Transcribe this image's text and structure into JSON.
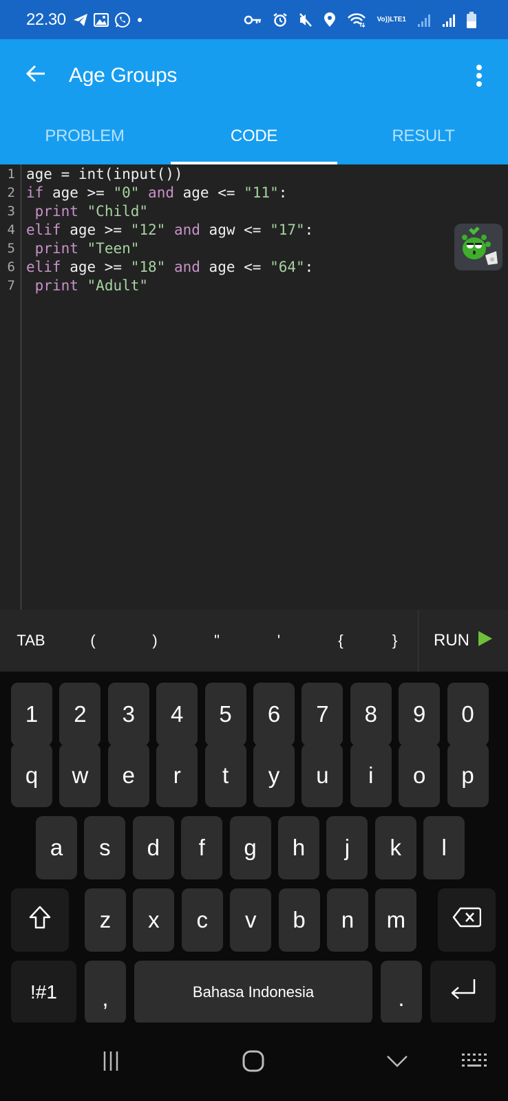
{
  "status_bar": {
    "time": "22.30",
    "left_icons": [
      "telegram-icon",
      "gallery-icon",
      "whatsapp-icon",
      "dot-icon"
    ],
    "right_icons": [
      "vpn-key-icon",
      "alarm-icon",
      "mute-icon",
      "location-icon",
      "wifi-icon",
      "volte-icon",
      "signal-icon",
      "signal-icon",
      "battery-icon"
    ],
    "volte_label": "Vo))",
    "lte_label": "LTE1"
  },
  "app_bar": {
    "title": "Age Groups",
    "back_icon": "arrow-left-icon",
    "menu_icon": "more-vert-icon",
    "tabs": [
      {
        "label": "PROBLEM",
        "active": false
      },
      {
        "label": "CODE",
        "active": true
      },
      {
        "label": "RESULT",
        "active": false
      }
    ]
  },
  "editor": {
    "lines": [
      {
        "num": "1",
        "tokens": [
          {
            "t": "plain",
            "v": "age = int(input())"
          }
        ]
      },
      {
        "num": "2",
        "tokens": [
          {
            "t": "kw",
            "v": "if"
          },
          {
            "t": "plain",
            "v": " age >= "
          },
          {
            "t": "str",
            "v": "\"0\""
          },
          {
            "t": "plain",
            "v": " "
          },
          {
            "t": "kw",
            "v": "and"
          },
          {
            "t": "plain",
            "v": " age <= "
          },
          {
            "t": "str",
            "v": "\"11\""
          },
          {
            "t": "plain",
            "v": ":"
          }
        ]
      },
      {
        "num": "3",
        "tokens": [
          {
            "t": "plain",
            "v": " "
          },
          {
            "t": "kw",
            "v": "print"
          },
          {
            "t": "plain",
            "v": " "
          },
          {
            "t": "str",
            "v": "\"Child\""
          }
        ]
      },
      {
        "num": "4",
        "tokens": [
          {
            "t": "kw",
            "v": "elif"
          },
          {
            "t": "plain",
            "v": " age >= "
          },
          {
            "t": "str",
            "v": "\"12\""
          },
          {
            "t": "plain",
            "v": " "
          },
          {
            "t": "kw",
            "v": "and"
          },
          {
            "t": "plain",
            "v": " agw <= "
          },
          {
            "t": "str",
            "v": "\"17\""
          },
          {
            "t": "plain",
            "v": ":"
          }
        ]
      },
      {
        "num": "5",
        "tokens": [
          {
            "t": "plain",
            "v": " "
          },
          {
            "t": "kw",
            "v": "print"
          },
          {
            "t": "plain",
            "v": " "
          },
          {
            "t": "str",
            "v": "\"Teen\""
          }
        ]
      },
      {
        "num": "6",
        "tokens": [
          {
            "t": "kw",
            "v": "elif"
          },
          {
            "t": "plain",
            "v": " age >= "
          },
          {
            "t": "str",
            "v": "\"18\""
          },
          {
            "t": "plain",
            "v": " "
          },
          {
            "t": "kw",
            "v": "and"
          },
          {
            "t": "plain",
            "v": " age <= "
          },
          {
            "t": "str",
            "v": "\"64\""
          },
          {
            "t": "plain",
            "v": ":"
          }
        ]
      },
      {
        "num": "7",
        "tokens": [
          {
            "t": "plain",
            "v": " "
          },
          {
            "t": "kw",
            "v": "print"
          },
          {
            "t": "plain",
            "v": " "
          },
          {
            "t": "str",
            "v": "\"Adult\""
          }
        ]
      }
    ],
    "floating_badge_icon": "mascot-icon"
  },
  "shortcut_bar": {
    "keys": [
      "TAB",
      "(",
      ")",
      "\"",
      "'",
      "{",
      "}"
    ],
    "run_label": "RUN",
    "run_icon": "play-icon"
  },
  "keyboard": {
    "number_row": [
      "1",
      "2",
      "3",
      "4",
      "5",
      "6",
      "7",
      "8",
      "9",
      "0"
    ],
    "row1": [
      "q",
      "w",
      "e",
      "r",
      "t",
      "y",
      "u",
      "i",
      "o",
      "p"
    ],
    "row2": [
      "a",
      "s",
      "d",
      "f",
      "g",
      "h",
      "j",
      "k",
      "l"
    ],
    "row3": [
      "z",
      "x",
      "c",
      "v",
      "b",
      "n",
      "m"
    ],
    "symbols_label": "!#1",
    "comma": ",",
    "space_label": "Bahasa Indonesia",
    "period": ".",
    "shift_icon": "shift-icon",
    "backspace_icon": "backspace-icon",
    "enter_icon": "enter-icon"
  },
  "nav_bar": {
    "icons": [
      "recent-apps-icon",
      "home-icon",
      "hide-keyboard-icon",
      "keyboard-switch-icon"
    ]
  },
  "colors": {
    "status_bar": "#1766c5",
    "app_bar": "#169df0",
    "editor_bg": "#222222",
    "keyword": "#c792c9",
    "string": "#a6d3a0",
    "run_play": "#6fbf3a"
  }
}
